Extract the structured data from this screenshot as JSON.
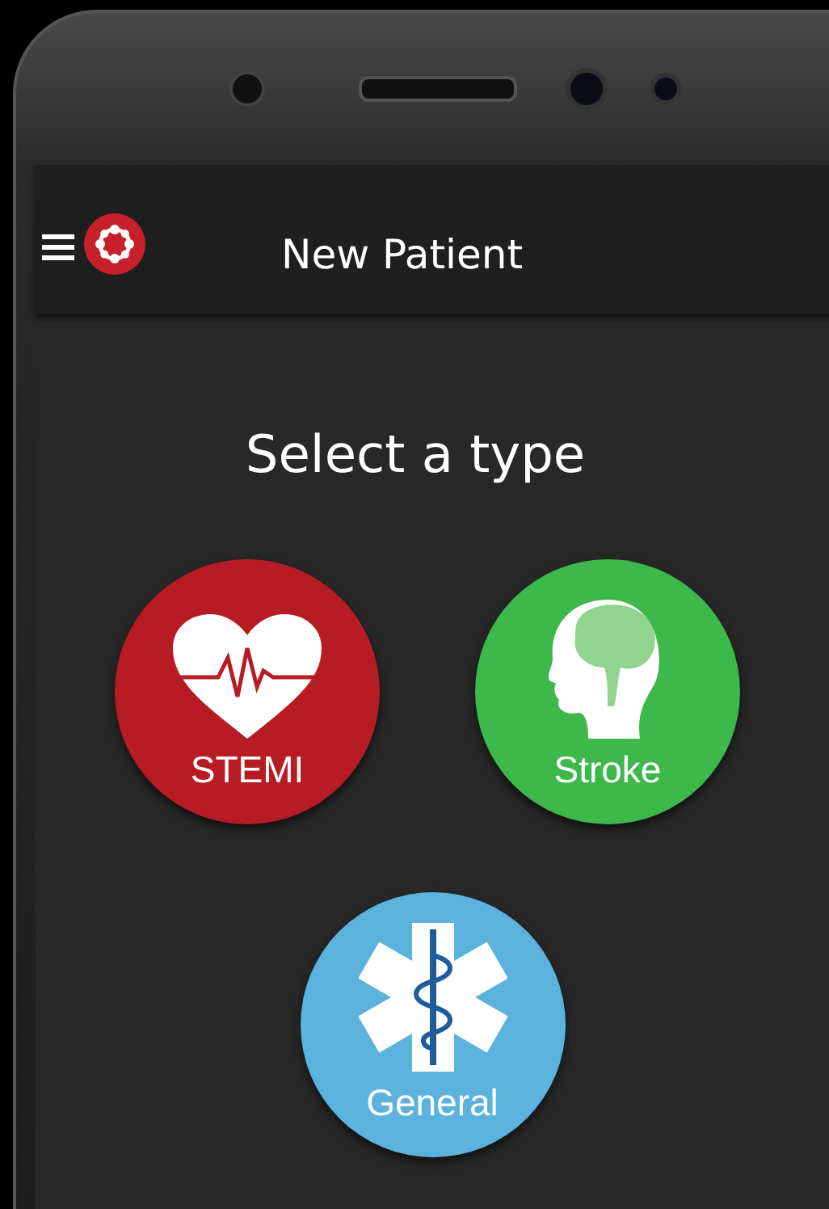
{
  "app_bar": {
    "title": "New Patient"
  },
  "heading": "Select a type",
  "types": [
    {
      "label": "STEMI",
      "kind": "heart",
      "color": "#b71c25"
    },
    {
      "label": "Stroke",
      "kind": "brain",
      "color": "#3db84b"
    },
    {
      "label": "General",
      "kind": "star",
      "color": "#5bb3dd"
    }
  ]
}
